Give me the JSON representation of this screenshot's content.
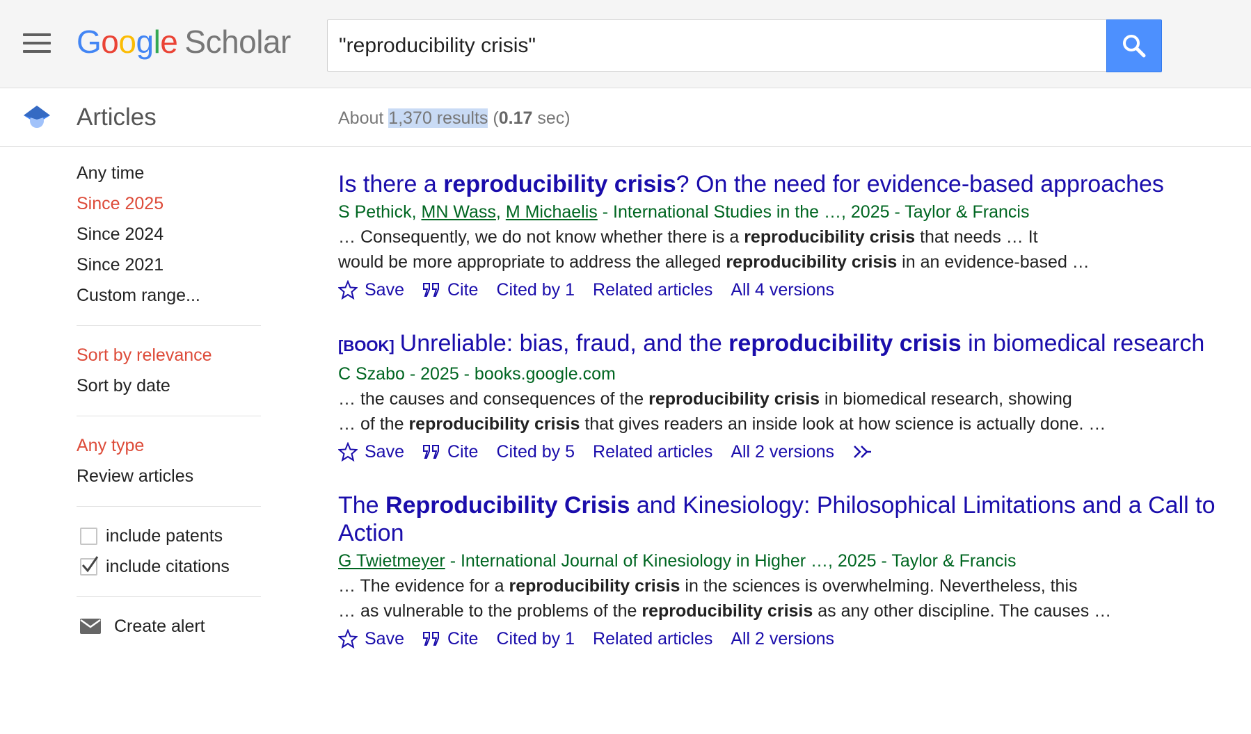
{
  "header": {
    "logo": {
      "google": [
        "G",
        "o",
        "o",
        "g",
        "l",
        "e"
      ],
      "scholar": "Scholar"
    },
    "search": {
      "query": "\"reproducibility crisis\""
    }
  },
  "subheader": {
    "section_title": "Articles",
    "results_prefix": "About",
    "results_count": "1,370 results",
    "time_prefix": "(",
    "time_value": "0.17",
    "time_suffix": "sec)"
  },
  "sidebar": {
    "time_filters": [
      "Any time",
      "Since 2025",
      "Since 2024",
      "Since 2021",
      "Custom range..."
    ],
    "active_time_filter": "Since 2025",
    "sort_options": [
      "Sort by relevance",
      "Sort by date"
    ],
    "active_sort": "Sort by relevance",
    "type_options": [
      "Any type",
      "Review articles"
    ],
    "active_type": "Any type",
    "checkboxes": [
      {
        "label": "include patents",
        "checked": false
      },
      {
        "label": "include citations",
        "checked": true
      }
    ],
    "create_alert": "Create alert"
  },
  "results": [
    {
      "title_parts": [
        {
          "text": "Is there a ",
          "bold": false
        },
        {
          "text": "reproducibility crisis",
          "bold": true
        },
        {
          "text": "? On the need for evidence-based approaches",
          "bold": false
        }
      ],
      "meta_parts": [
        {
          "text": "S Pethick, ",
          "link": false
        },
        {
          "text": "MN Wass",
          "link": true
        },
        {
          "text": ", ",
          "link": false
        },
        {
          "text": "M Michaelis",
          "link": true
        },
        {
          "text": " - International Studies in the …, 2025 - Taylor & Francis",
          "link": false
        }
      ],
      "snippet_lines": [
        [
          {
            "text": "… Consequently, we do not know whether there is a ",
            "bold": false
          },
          {
            "text": "reproducibility crisis",
            "bold": true
          },
          {
            "text": " that needs … It",
            "bold": false
          }
        ],
        [
          {
            "text": "would be more appropriate to address the alleged ",
            "bold": false
          },
          {
            "text": "reproducibility crisis",
            "bold": true
          },
          {
            "text": " in an evidence-based …",
            "bold": false
          }
        ]
      ],
      "actions": {
        "save": "Save",
        "cite": "Cite",
        "cited_by": "Cited by 1",
        "related": "Related articles",
        "versions": "All 4 versions"
      }
    },
    {
      "title_prefix": "[BOOK]",
      "title_parts": [
        {
          "text": "Unreliable: bias, fraud, and the ",
          "bold": false
        },
        {
          "text": "reproducibility crisis",
          "bold": true
        },
        {
          "text": " in biomedical research",
          "bold": false
        }
      ],
      "meta_parts": [
        {
          "text": "C Szabo - 2025 - books.google.com",
          "link": false
        }
      ],
      "snippet_lines": [
        [
          {
            "text": "… the causes and consequences of the ",
            "bold": false
          },
          {
            "text": "reproducibility crisis",
            "bold": true
          },
          {
            "text": " in biomedical research, showing",
            "bold": false
          }
        ],
        [
          {
            "text": "… of the ",
            "bold": false
          },
          {
            "text": "reproducibility crisis",
            "bold": true
          },
          {
            "text": " that gives readers an inside look at how science is actually done. …",
            "bold": false
          }
        ]
      ],
      "actions": {
        "save": "Save",
        "cite": "Cite",
        "cited_by": "Cited by 5",
        "related": "Related articles",
        "versions": "All 2 versions"
      },
      "has_more_icon": true
    },
    {
      "title_parts": [
        {
          "text": "The ",
          "bold": false
        },
        {
          "text": "Reproducibility Crisis",
          "bold": true
        },
        {
          "text": " and Kinesiology: Philosophical Limitations and a Call to Action",
          "bold": false
        }
      ],
      "meta_parts": [
        {
          "text": "G Twietmeyer",
          "link": true
        },
        {
          "text": " - International Journal of Kinesiology in Higher …, 2025 - Taylor & Francis",
          "link": false
        }
      ],
      "snippet_lines": [
        [
          {
            "text": "… The evidence for a ",
            "bold": false
          },
          {
            "text": "reproducibility crisis",
            "bold": true
          },
          {
            "text": " in the sciences is overwhelming. Nevertheless, this",
            "bold": false
          }
        ],
        [
          {
            "text": "… as vulnerable to the problems of the ",
            "bold": false
          },
          {
            "text": "reproducibility crisis",
            "bold": true
          },
          {
            "text": " as any other discipline. The causes …",
            "bold": false
          }
        ]
      ],
      "actions": {
        "save": "Save",
        "cite": "Cite",
        "cited_by": "Cited by 1",
        "related": "Related articles",
        "versions": "All 2 versions"
      }
    }
  ],
  "colors": {
    "link_blue": "#1a0dab",
    "meta_green": "#006621",
    "active_red": "#dd4b39",
    "search_button": "#4d90fe",
    "results_highlight": "#c9dbf5"
  },
  "icons": {
    "menu": "hamburger-menu-icon",
    "search": "magnifier-icon",
    "articles": "scholar-cap-icon",
    "save": "star-outline-icon",
    "cite": "quote-icon",
    "more": "double-chevron-icon",
    "alert": "envelope-icon"
  }
}
